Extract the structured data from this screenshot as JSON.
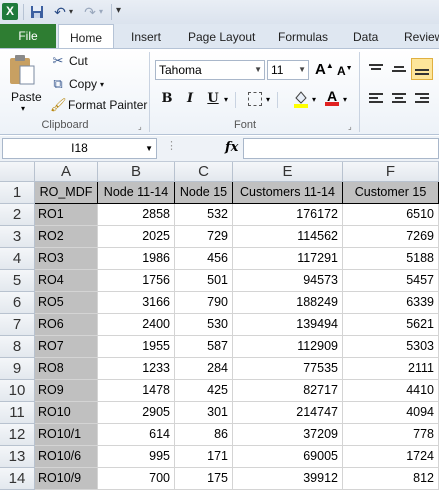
{
  "app": {
    "logo_letter": "X"
  },
  "qat": {
    "save_icon": "save-icon",
    "undo_icon": "undo-icon",
    "redo_icon": "redo-icon"
  },
  "tabs": [
    {
      "label": "File"
    },
    {
      "label": "Home"
    },
    {
      "label": "Insert"
    },
    {
      "label": "Page Layout"
    },
    {
      "label": "Formulas"
    },
    {
      "label": "Data"
    },
    {
      "label": "Review"
    }
  ],
  "clipboard": {
    "paste": "Paste",
    "cut": "Cut",
    "copy": "Copy",
    "format_painter": "Format Painter",
    "group": "Clipboard"
  },
  "font": {
    "name": "Tahoma",
    "size": "11",
    "bold": "B",
    "italic": "I",
    "underline": "U",
    "group": "Font"
  },
  "formula_bar": {
    "name_box": "I18",
    "fx": "fx",
    "formula": ""
  },
  "grid": {
    "columns": [
      "A",
      "B",
      "C",
      "E",
      "F"
    ],
    "rows": [
      "1",
      "2",
      "3",
      "4",
      "5",
      "6",
      "7",
      "8",
      "9",
      "10",
      "11",
      "12",
      "13",
      "14"
    ],
    "header": [
      "RO_MDF",
      "Node 11-14",
      "Node 15",
      "Customers 11-14",
      "Customer 15"
    ],
    "data": [
      [
        "RO1",
        "2858",
        "532",
        "176172",
        "6510"
      ],
      [
        "RO2",
        "2025",
        "729",
        "114562",
        "7269"
      ],
      [
        "RO3",
        "1986",
        "456",
        "117291",
        "5188"
      ],
      [
        "RO4",
        "1756",
        "501",
        "94573",
        "5457"
      ],
      [
        "RO5",
        "3166",
        "790",
        "188249",
        "6339"
      ],
      [
        "RO6",
        "2400",
        "530",
        "139494",
        "5621"
      ],
      [
        "RO7",
        "1955",
        "587",
        "112909",
        "5303"
      ],
      [
        "RO8",
        "1233",
        "284",
        "77535",
        "2111"
      ],
      [
        "RO9",
        "1478",
        "425",
        "82717",
        "4410"
      ],
      [
        "RO10",
        "2905",
        "301",
        "214747",
        "4094"
      ],
      [
        "RO10/1",
        "614",
        "86",
        "37209",
        "778"
      ],
      [
        "RO10/6",
        "995",
        "171",
        "69005",
        "1724"
      ],
      [
        "RO10/9",
        "700",
        "175",
        "39912",
        "812"
      ]
    ]
  },
  "colors": {
    "file_tab": "#2e7d32",
    "header_fill": "#c0c0c0"
  }
}
